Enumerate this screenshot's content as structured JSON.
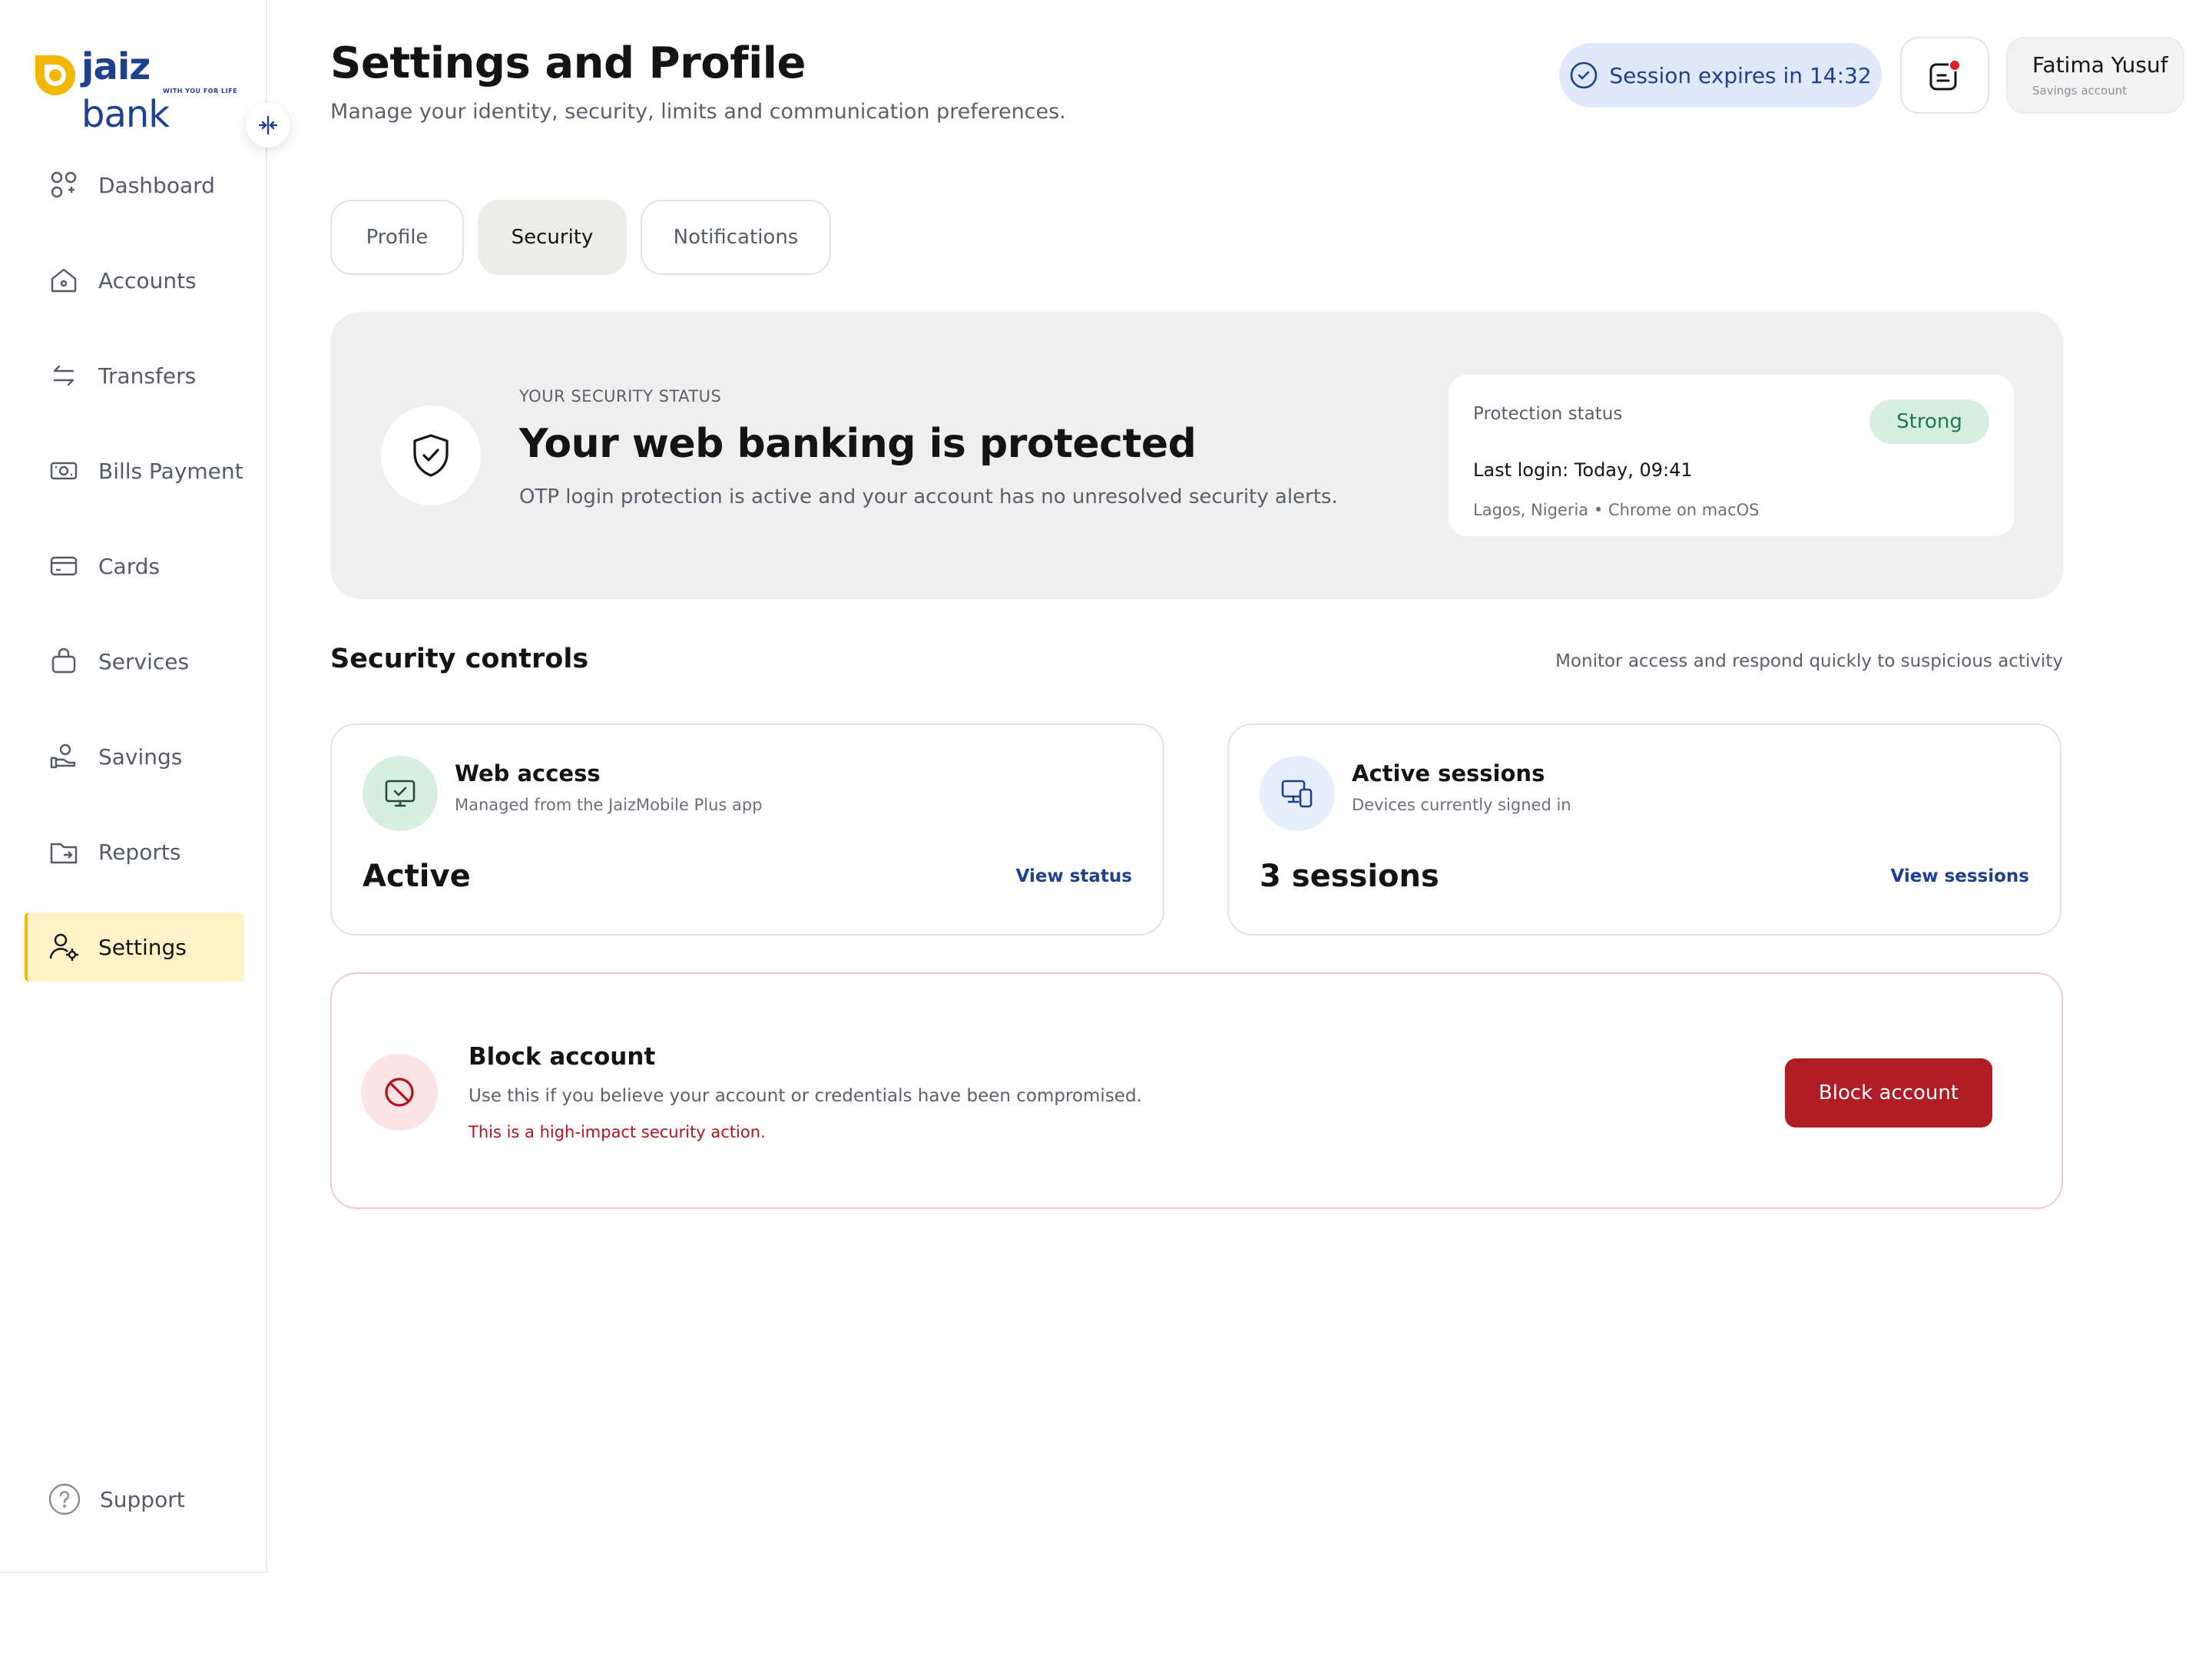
{
  "brand": {
    "name_part1": "jaiz",
    "name_part2": "bank",
    "tagline": "WITH YOU FOR LIFE",
    "accent_color": "#f2b705",
    "primary_color": "#1f3f8f"
  },
  "sidebar": {
    "items": [
      {
        "label": "Dashboard",
        "icon": "dashboard-icon"
      },
      {
        "label": "Accounts",
        "icon": "home-icon"
      },
      {
        "label": "Transfers",
        "icon": "transfer-arrows-icon"
      },
      {
        "label": "Bills Payment",
        "icon": "bill-icon"
      },
      {
        "label": "Cards",
        "icon": "card-icon"
      },
      {
        "label": "Services",
        "icon": "bag-icon"
      },
      {
        "label": "Savings",
        "icon": "savings-hand-icon"
      },
      {
        "label": "Reports",
        "icon": "folder-icon"
      },
      {
        "label": "Settings",
        "icon": "user-gear-icon",
        "active": true
      }
    ],
    "support_label": "Support"
  },
  "header": {
    "title": "Settings and Profile",
    "subtitle": "Manage your identity, security, limits and communication preferences.",
    "session_text": "Session expires in 14:32",
    "user_name": "Fatima Yusuf",
    "user_account_type": "Savings account"
  },
  "tabs": [
    {
      "label": "Profile"
    },
    {
      "label": "Security",
      "active": true
    },
    {
      "label": "Notifications"
    }
  ],
  "security_status": {
    "eyebrow": "YOUR SECURITY STATUS",
    "title": "Your web banking is protected",
    "description": "OTP login protection is active and your account has no unresolved security alerts.",
    "protection_label": "Protection status",
    "protection_level": "Strong",
    "last_login": "Last login: Today, 09:41",
    "login_location": "Lagos, Nigeria • Chrome on macOS"
  },
  "controls": {
    "title": "Security controls",
    "hint": "Monitor access and respond quickly to suspicious activity",
    "cards": [
      {
        "title": "Web access",
        "subtitle": "Managed from the JaizMobile Plus app",
        "value": "Active",
        "link": "View status",
        "icon": "monitor-check-icon"
      },
      {
        "title": "Active sessions",
        "subtitle": "Devices currently signed in",
        "value": "3 sessions",
        "link": "View sessions",
        "icon": "devices-icon"
      }
    ]
  },
  "block_account": {
    "title": "Block account",
    "description": "Use this if you believe your account or credentials have been compromised.",
    "warning": "This is a high-impact security action.",
    "button_label": "Block account",
    "danger_color": "#b01c24"
  }
}
